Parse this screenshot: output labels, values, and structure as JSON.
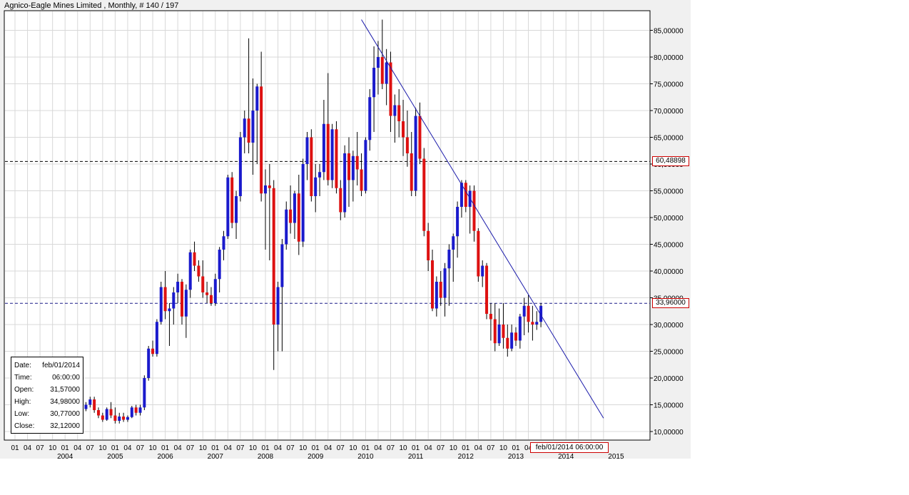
{
  "window": {
    "title": "Agnico-Eagle Mines Limited , Monthly, # 140 / 197"
  },
  "info_box": {
    "date_label": "Date:",
    "date": "feb/01/2014",
    "time_label": "Time:",
    "time": "06:00:00",
    "open_label": "Open:",
    "open": "31,57000",
    "high_label": "High:",
    "high": "34,98000",
    "low_label": "Low:",
    "low": "30,77000",
    "close_label": "Close:",
    "close": "32,12000"
  },
  "price_labels": {
    "resistance": "60,48898",
    "current": "33,96000"
  },
  "cursor_label": "feb/01/2014 06:00:00",
  "colors": {
    "up": "#1a1acc",
    "down": "#dd1111",
    "trendline": "#1a1aaa",
    "grid": "#d8d8d8",
    "hline_black": "#000000",
    "hline_blue": "#1a1a88"
  },
  "chart_data": {
    "type": "candlestick",
    "title": "Agnico-Eagle Mines Limited , Monthly, # 140 / 197",
    "ylim": [
      8,
      88
    ],
    "y_ticks": [
      10,
      15,
      20,
      25,
      30,
      35,
      40,
      45,
      50,
      55,
      60,
      65,
      70,
      75,
      80,
      85
    ],
    "y_tick_labels": [
      "10,00000",
      "15,00000",
      "20,00000",
      "25,00000",
      "30,00000",
      "35,00000",
      "40,00000",
      "45,00000",
      "50,00000",
      "55,00000",
      "60,00000",
      "65,00000",
      "70,00000",
      "75,00000",
      "80,00000",
      "85,00000"
    ],
    "x_range": [
      "2004-01",
      "2015-10"
    ],
    "month_tick_labels": [
      "01",
      "04",
      "07",
      "10"
    ],
    "year_labels": [
      "2004",
      "2005",
      "2006",
      "2007",
      "2008",
      "2009",
      "2010",
      "2011",
      "2012",
      "2013",
      "2014",
      "2015"
    ],
    "horizontal_lines": [
      60.49,
      33.96
    ],
    "trendline": {
      "from": [
        "2010-12",
        87.0
      ],
      "to": [
        "2015-10",
        12.5
      ]
    },
    "candles": [
      {
        "d": "2004-01",
        "o": 13.0,
        "h": 14.5,
        "l": 11.5,
        "c": 12.0
      },
      {
        "d": "2004-02",
        "o": 12.0,
        "h": 13.0,
        "l": 10.5,
        "c": 11.0
      },
      {
        "d": "2004-03",
        "o": 11.0,
        "h": 13.5,
        "l": 10.8,
        "c": 12.8
      },
      {
        "d": "2004-04",
        "o": 12.8,
        "h": 13.5,
        "l": 11.0,
        "c": 11.5
      },
      {
        "d": "2004-05",
        "o": 11.5,
        "h": 12.5,
        "l": 10.5,
        "c": 11.2
      },
      {
        "d": "2004-06",
        "o": 11.2,
        "h": 12.8,
        "l": 11.0,
        "c": 12.5
      },
      {
        "d": "2004-07",
        "o": 12.5,
        "h": 13.5,
        "l": 11.5,
        "c": 13.0
      },
      {
        "d": "2004-08",
        "o": 13.0,
        "h": 14.0,
        "l": 12.0,
        "c": 12.3
      },
      {
        "d": "2004-09",
        "o": 12.3,
        "h": 14.2,
        "l": 12.0,
        "c": 14.0
      },
      {
        "d": "2004-10",
        "o": 14.0,
        "h": 14.8,
        "l": 12.5,
        "c": 13.0
      },
      {
        "d": "2004-11",
        "o": 13.0,
        "h": 14.5,
        "l": 12.8,
        "c": 14.2
      },
      {
        "d": "2004-12",
        "o": 14.2,
        "h": 14.5,
        "l": 12.8,
        "c": 13.5
      },
      {
        "d": "2005-01",
        "o": 13.5,
        "h": 14.0,
        "l": 12.0,
        "c": 12.3
      },
      {
        "d": "2005-02",
        "o": 12.3,
        "h": 13.5,
        "l": 12.0,
        "c": 13.2
      },
      {
        "d": "2005-03",
        "o": 13.2,
        "h": 13.8,
        "l": 12.2,
        "c": 12.5
      },
      {
        "d": "2005-04",
        "o": 12.5,
        "h": 13.5,
        "l": 12.0,
        "c": 13.0
      },
      {
        "d": "2005-05",
        "o": 13.0,
        "h": 14.5,
        "l": 12.8,
        "c": 14.2
      },
      {
        "d": "2005-06",
        "o": 14.2,
        "h": 15.5,
        "l": 13.8,
        "c": 15.0
      },
      {
        "d": "2005-07",
        "o": 15.0,
        "h": 16.5,
        "l": 14.5,
        "c": 16.0
      },
      {
        "d": "2005-08",
        "o": 16.0,
        "h": 16.5,
        "l": 13.5,
        "c": 14.0
      },
      {
        "d": "2005-09",
        "o": 14.0,
        "h": 14.5,
        "l": 12.5,
        "c": 13.0
      },
      {
        "d": "2005-10",
        "o": 13.0,
        "h": 13.5,
        "l": 11.8,
        "c": 12.2
      },
      {
        "d": "2005-11",
        "o": 12.2,
        "h": 14.5,
        "l": 12.0,
        "c": 14.2
      },
      {
        "d": "2005-12",
        "o": 14.2,
        "h": 15.5,
        "l": 12.5,
        "c": 13.0
      },
      {
        "d": "2006-01",
        "o": 13.0,
        "h": 14.5,
        "l": 11.5,
        "c": 12.0
      },
      {
        "d": "2006-02",
        "o": 12.0,
        "h": 13.5,
        "l": 11.5,
        "c": 12.8
      },
      {
        "d": "2006-03",
        "o": 12.8,
        "h": 13.5,
        "l": 11.8,
        "c": 12.2
      },
      {
        "d": "2006-04",
        "o": 12.2,
        "h": 13.0,
        "l": 11.8,
        "c": 12.7
      },
      {
        "d": "2006-05",
        "o": 12.7,
        "h": 14.8,
        "l": 12.5,
        "c": 14.5
      },
      {
        "d": "2006-06",
        "o": 14.5,
        "h": 15.0,
        "l": 13.0,
        "c": 13.5
      },
      {
        "d": "2006-07",
        "o": 13.5,
        "h": 15.0,
        "l": 13.0,
        "c": 14.5
      },
      {
        "d": "2006-08",
        "o": 14.5,
        "h": 20.5,
        "l": 14.0,
        "c": 20.0
      },
      {
        "d": "2006-09",
        "o": 20.0,
        "h": 26.0,
        "l": 19.5,
        "c": 25.5
      },
      {
        "d": "2006-10",
        "o": 25.5,
        "h": 27.0,
        "l": 24.0,
        "c": 24.5
      },
      {
        "d": "2006-11",
        "o": 24.5,
        "h": 31.0,
        "l": 24.0,
        "c": 30.5
      },
      {
        "d": "2006-12",
        "o": 30.5,
        "h": 38.0,
        "l": 30.0,
        "c": 37.0
      },
      {
        "d": "2007-01",
        "o": 37.0,
        "h": 40.0,
        "l": 31.0,
        "c": 32.5
      },
      {
        "d": "2007-02",
        "o": 32.5,
        "h": 34.0,
        "l": 26.0,
        "c": 33.0
      },
      {
        "d": "2007-03",
        "o": 33.0,
        "h": 37.0,
        "l": 30.0,
        "c": 36.0
      },
      {
        "d": "2007-04",
        "o": 36.0,
        "h": 39.5,
        "l": 34.0,
        "c": 38.0
      },
      {
        "d": "2007-05",
        "o": 38.0,
        "h": 38.5,
        "l": 30.0,
        "c": 31.5
      },
      {
        "d": "2007-06",
        "o": 31.5,
        "h": 37.5,
        "l": 27.5,
        "c": 36.5
      },
      {
        "d": "2007-07",
        "o": 36.5,
        "h": 44.0,
        "l": 35.0,
        "c": 43.5
      },
      {
        "d": "2007-08",
        "o": 43.5,
        "h": 45.5,
        "l": 40.0,
        "c": 41.0
      },
      {
        "d": "2007-09",
        "o": 41.0,
        "h": 42.0,
        "l": 38.0,
        "c": 39.0
      },
      {
        "d": "2007-10",
        "o": 39.0,
        "h": 42.0,
        "l": 35.0,
        "c": 36.0
      },
      {
        "d": "2007-11",
        "o": 36.0,
        "h": 38.0,
        "l": 34.0,
        "c": 35.5
      },
      {
        "d": "2007-12",
        "o": 35.5,
        "h": 37.0,
        "l": 33.5,
        "c": 34.0
      },
      {
        "d": "2008-01",
        "o": 34.0,
        "h": 39.5,
        "l": 33.5,
        "c": 38.5
      },
      {
        "d": "2008-02",
        "o": 38.5,
        "h": 44.5,
        "l": 36.0,
        "c": 44.0
      },
      {
        "d": "2008-03",
        "o": 44.0,
        "h": 47.5,
        "l": 42.0,
        "c": 46.5
      },
      {
        "d": "2008-04",
        "o": 46.5,
        "h": 58.0,
        "l": 46.0,
        "c": 57.5
      },
      {
        "d": "2008-05",
        "o": 57.5,
        "h": 58.5,
        "l": 48.0,
        "c": 49.0
      },
      {
        "d": "2008-06",
        "o": 49.0,
        "h": 55.0,
        "l": 46.0,
        "c": 54.0
      },
      {
        "d": "2008-07",
        "o": 54.0,
        "h": 66.0,
        "l": 53.0,
        "c": 65.0
      },
      {
        "d": "2008-08",
        "o": 65.0,
        "h": 70.0,
        "l": 62.0,
        "c": 68.5
      },
      {
        "d": "2008-09",
        "o": 68.5,
        "h": 83.5,
        "l": 62.0,
        "c": 64.0
      },
      {
        "d": "2008-10",
        "o": 64.0,
        "h": 76.0,
        "l": 58.0,
        "c": 70.0
      },
      {
        "d": "2008-11",
        "o": 70.0,
        "h": 75.0,
        "l": 60.0,
        "c": 74.5
      },
      {
        "d": "2008-12",
        "o": 74.5,
        "h": 81.0,
        "l": 53.0,
        "c": 54.5
      },
      {
        "d": "2009-01",
        "o": 54.5,
        "h": 59.0,
        "l": 44.0,
        "c": 56.0
      },
      {
        "d": "2009-02",
        "o": 56.0,
        "h": 60.0,
        "l": 42.0,
        "c": 55.5
      },
      {
        "d": "2009-03",
        "o": 55.5,
        "h": 57.0,
        "l": 21.5,
        "c": 30.0
      },
      {
        "d": "2009-04",
        "o": 30.0,
        "h": 38.0,
        "l": 25.0,
        "c": 37.0
      },
      {
        "d": "2009-05",
        "o": 37.0,
        "h": 46.0,
        "l": 25.0,
        "c": 45.0
      },
      {
        "d": "2009-06",
        "o": 45.0,
        "h": 53.0,
        "l": 44.0,
        "c": 51.5
      },
      {
        "d": "2009-07",
        "o": 51.5,
        "h": 56.0,
        "l": 47.0,
        "c": 49.0
      },
      {
        "d": "2009-08",
        "o": 49.0,
        "h": 55.0,
        "l": 46.0,
        "c": 54.5
      },
      {
        "d": "2009-09",
        "o": 54.5,
        "h": 58.0,
        "l": 43.0,
        "c": 45.5
      },
      {
        "d": "2009-10",
        "o": 45.5,
        "h": 61.0,
        "l": 44.5,
        "c": 60.0
      },
      {
        "d": "2009-11",
        "o": 60.0,
        "h": 66.0,
        "l": 57.0,
        "c": 65.0
      },
      {
        "d": "2009-12",
        "o": 65.0,
        "h": 66.5,
        "l": 53.0,
        "c": 54.0
      },
      {
        "d": "2010-01",
        "o": 54.0,
        "h": 60.0,
        "l": 51.0,
        "c": 57.5
      },
      {
        "d": "2010-02",
        "o": 57.5,
        "h": 60.0,
        "l": 54.0,
        "c": 58.5
      },
      {
        "d": "2010-03",
        "o": 58.5,
        "h": 72.0,
        "l": 57.0,
        "c": 67.5
      },
      {
        "d": "2010-04",
        "o": 67.5,
        "h": 77.0,
        "l": 56.0,
        "c": 57.0
      },
      {
        "d": "2010-05",
        "o": 57.0,
        "h": 67.5,
        "l": 55.5,
        "c": 66.5
      },
      {
        "d": "2010-06",
        "o": 66.5,
        "h": 68.0,
        "l": 54.5,
        "c": 55.5
      },
      {
        "d": "2010-07",
        "o": 55.5,
        "h": 57.0,
        "l": 49.5,
        "c": 51.0
      },
      {
        "d": "2010-08",
        "o": 51.0,
        "h": 63.5,
        "l": 50.0,
        "c": 62.0
      },
      {
        "d": "2010-09",
        "o": 62.0,
        "h": 65.0,
        "l": 52.0,
        "c": 57.0
      },
      {
        "d": "2010-10",
        "o": 57.0,
        "h": 62.5,
        "l": 53.0,
        "c": 61.5
      },
      {
        "d": "2010-11",
        "o": 61.5,
        "h": 66.0,
        "l": 56.0,
        "c": 59.0
      },
      {
        "d": "2010-12",
        "o": 59.0,
        "h": 62.0,
        "l": 54.0,
        "c": 55.0
      },
      {
        "d": "2011-01",
        "o": 55.0,
        "h": 65.0,
        "l": 54.5,
        "c": 64.5
      },
      {
        "d": "2011-02",
        "o": 64.5,
        "h": 74.0,
        "l": 62.5,
        "c": 72.5
      },
      {
        "d": "2011-03",
        "o": 72.5,
        "h": 82.0,
        "l": 66.0,
        "c": 78.0
      },
      {
        "d": "2011-04",
        "o": 78.0,
        "h": 83.0,
        "l": 73.0,
        "c": 80.0
      },
      {
        "d": "2011-05",
        "o": 80.0,
        "h": 87.0,
        "l": 74.0,
        "c": 75.0
      },
      {
        "d": "2011-06",
        "o": 75.0,
        "h": 81.5,
        "l": 71.0,
        "c": 79.0
      },
      {
        "d": "2011-07",
        "o": 79.0,
        "h": 81.0,
        "l": 66.0,
        "c": 69.0
      },
      {
        "d": "2011-08",
        "o": 69.0,
        "h": 73.0,
        "l": 64.0,
        "c": 71.0
      },
      {
        "d": "2011-09",
        "o": 71.0,
        "h": 74.0,
        "l": 65.0,
        "c": 68.0
      },
      {
        "d": "2011-10",
        "o": 68.0,
        "h": 72.0,
        "l": 61.5,
        "c": 65.0
      },
      {
        "d": "2011-11",
        "o": 65.0,
        "h": 70.0,
        "l": 59.5,
        "c": 62.0
      },
      {
        "d": "2011-12",
        "o": 62.0,
        "h": 66.0,
        "l": 54.0,
        "c": 55.0
      },
      {
        "d": "2012-01",
        "o": 55.0,
        "h": 70.5,
        "l": 54.0,
        "c": 69.0
      },
      {
        "d": "2012-02",
        "o": 69.0,
        "h": 71.5,
        "l": 60.0,
        "c": 61.0
      },
      {
        "d": "2012-03",
        "o": 61.0,
        "h": 63.0,
        "l": 46.5,
        "c": 47.5
      },
      {
        "d": "2012-04",
        "o": 47.5,
        "h": 49.0,
        "l": 40.0,
        "c": 42.0
      },
      {
        "d": "2012-05",
        "o": 42.0,
        "h": 44.0,
        "l": 32.5,
        "c": 33.0
      },
      {
        "d": "2012-06",
        "o": 33.0,
        "h": 39.0,
        "l": 31.5,
        "c": 38.0
      },
      {
        "d": "2012-07",
        "o": 38.0,
        "h": 40.0,
        "l": 33.5,
        "c": 35.0
      },
      {
        "d": "2012-08",
        "o": 35.0,
        "h": 41.5,
        "l": 31.5,
        "c": 40.5
      },
      {
        "d": "2012-09",
        "o": 40.5,
        "h": 45.0,
        "l": 33.5,
        "c": 44.0
      },
      {
        "d": "2012-10",
        "o": 44.0,
        "h": 47.0,
        "l": 38.0,
        "c": 46.5
      },
      {
        "d": "2012-11",
        "o": 46.5,
        "h": 53.0,
        "l": 42.5,
        "c": 52.0
      },
      {
        "d": "2012-12",
        "o": 52.0,
        "h": 57.0,
        "l": 50.0,
        "c": 56.5
      },
      {
        "d": "2013-01",
        "o": 56.5,
        "h": 57.0,
        "l": 51.0,
        "c": 52.0
      },
      {
        "d": "2013-02",
        "o": 52.0,
        "h": 56.0,
        "l": 47.0,
        "c": 55.0
      },
      {
        "d": "2013-03",
        "o": 55.0,
        "h": 56.0,
        "l": 45.5,
        "c": 47.5
      },
      {
        "d": "2013-04",
        "o": 47.5,
        "h": 48.0,
        "l": 38.0,
        "c": 39.0
      },
      {
        "d": "2013-05",
        "o": 39.0,
        "h": 42.0,
        "l": 37.0,
        "c": 41.0
      },
      {
        "d": "2013-06",
        "o": 41.0,
        "h": 41.5,
        "l": 31.0,
        "c": 32.0
      },
      {
        "d": "2013-07",
        "o": 32.0,
        "h": 34.0,
        "l": 27.0,
        "c": 31.0
      },
      {
        "d": "2013-08",
        "o": 31.0,
        "h": 34.0,
        "l": 25.0,
        "c": 26.5
      },
      {
        "d": "2013-09",
        "o": 26.5,
        "h": 33.0,
        "l": 26.0,
        "c": 30.0
      },
      {
        "d": "2013-10",
        "o": 30.0,
        "h": 34.0,
        "l": 25.5,
        "c": 27.5
      },
      {
        "d": "2013-11",
        "o": 27.5,
        "h": 30.0,
        "l": 24.0,
        "c": 25.5
      },
      {
        "d": "2013-12",
        "o": 25.5,
        "h": 30.0,
        "l": 25.0,
        "c": 28.5
      },
      {
        "d": "2014-01",
        "o": 28.5,
        "h": 29.5,
        "l": 26.0,
        "c": 27.0
      },
      {
        "d": "2014-02",
        "o": 27.0,
        "h": 32.0,
        "l": 25.5,
        "c": 31.5
      },
      {
        "d": "2014-03",
        "o": 31.5,
        "h": 35.0,
        "l": 28.0,
        "c": 33.5
      },
      {
        "d": "2014-04",
        "o": 33.5,
        "h": 35.5,
        "l": 28.5,
        "c": 30.5
      },
      {
        "d": "2014-05",
        "o": 30.5,
        "h": 33.5,
        "l": 27.0,
        "c": 30.0
      },
      {
        "d": "2014-06",
        "o": 30.0,
        "h": 32.5,
        "l": 29.0,
        "c": 30.5
      },
      {
        "d": "2014-07",
        "o": 30.5,
        "h": 34.0,
        "l": 29.5,
        "c": 33.5
      }
    ]
  }
}
